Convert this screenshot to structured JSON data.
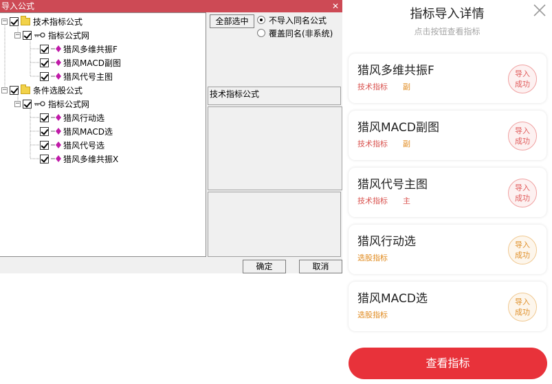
{
  "dialog": {
    "title": "导入公式",
    "close_glyph": "✕",
    "select_all_label": "全部选中",
    "radio_no_import": "不导入同名公式",
    "radio_overwrite": "覆盖同名(非系统)",
    "group_label": "技术指标公式",
    "ok_label": "确定",
    "cancel_label": "取消",
    "tree": {
      "group1": "技术指标公式",
      "net1": "指标公式网",
      "g1_items": [
        "猎风多维共振F",
        "猎风MACD副图",
        "猎风代号主图"
      ],
      "group2": "条件选股公式",
      "net2": "指标公式网",
      "g2_items": [
        "猎风行动选",
        "猎风MACD选",
        "猎风代号选",
        "猎风多维共振X"
      ]
    }
  },
  "mobile": {
    "title": "指标导入详情",
    "subtitle": "点击按钮查看指标",
    "cards": [
      {
        "name": "猎风多维共振F",
        "tag1": "技术指标",
        "tag2": "副",
        "badge_line1": "导入",
        "badge_line2": "成功"
      },
      {
        "name": "猎风MACD副图",
        "tag1": "技术指标",
        "tag2": "副",
        "badge_line1": "导入",
        "badge_line2": "成功"
      },
      {
        "name": "猎风代号主图",
        "tag1": "技术指标",
        "tag2": "主",
        "badge_line1": "导入",
        "badge_line2": "成功"
      },
      {
        "name": "猎风行动选",
        "tag1": "选股指标",
        "badge_line1": "导入",
        "badge_line2": "成功"
      },
      {
        "name": "猎风MACD选",
        "tag1": "选股指标",
        "badge_line1": "导入",
        "badge_line2": "成功"
      }
    ],
    "button_label": "查看指标",
    "colors": {
      "accent": "#e8323a",
      "tech_badge": "#e05a5a",
      "select_badge": "#e0902a"
    }
  }
}
